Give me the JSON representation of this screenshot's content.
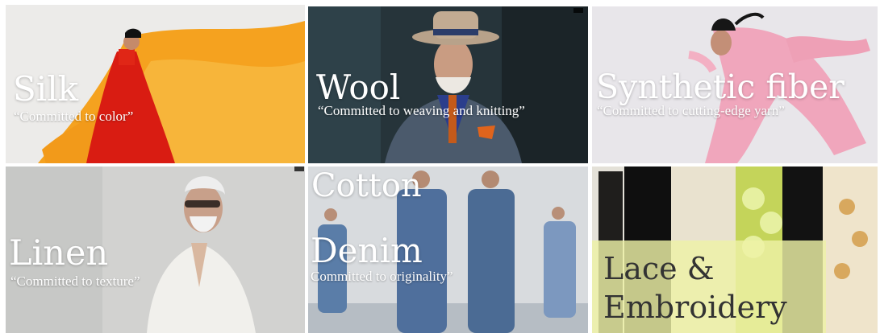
{
  "tiles": {
    "silk": {
      "title": "Silk",
      "tagline": "“Committed to color”"
    },
    "wool": {
      "title": "Wool",
      "tagline": "“Committed to weaving and knitting”"
    },
    "synthetic": {
      "title": "Synthetic fiber",
      "tagline": "“Committed to cutting-edge yarn”"
    },
    "linen": {
      "title": "Linen",
      "tagline": "“Committed to texture”"
    },
    "cotton_denim": {
      "title_top": "Cotton",
      "title": "Denim",
      "tagline": "Committed to originality”"
    },
    "lace": {
      "title_line1": "Lace &",
      "title_line2": "Embroidery"
    }
  },
  "colors": {
    "background": "#ffffff",
    "text_light": "#ffffff",
    "text_dark": "#333333",
    "lace_panel": "#eef2a6"
  }
}
